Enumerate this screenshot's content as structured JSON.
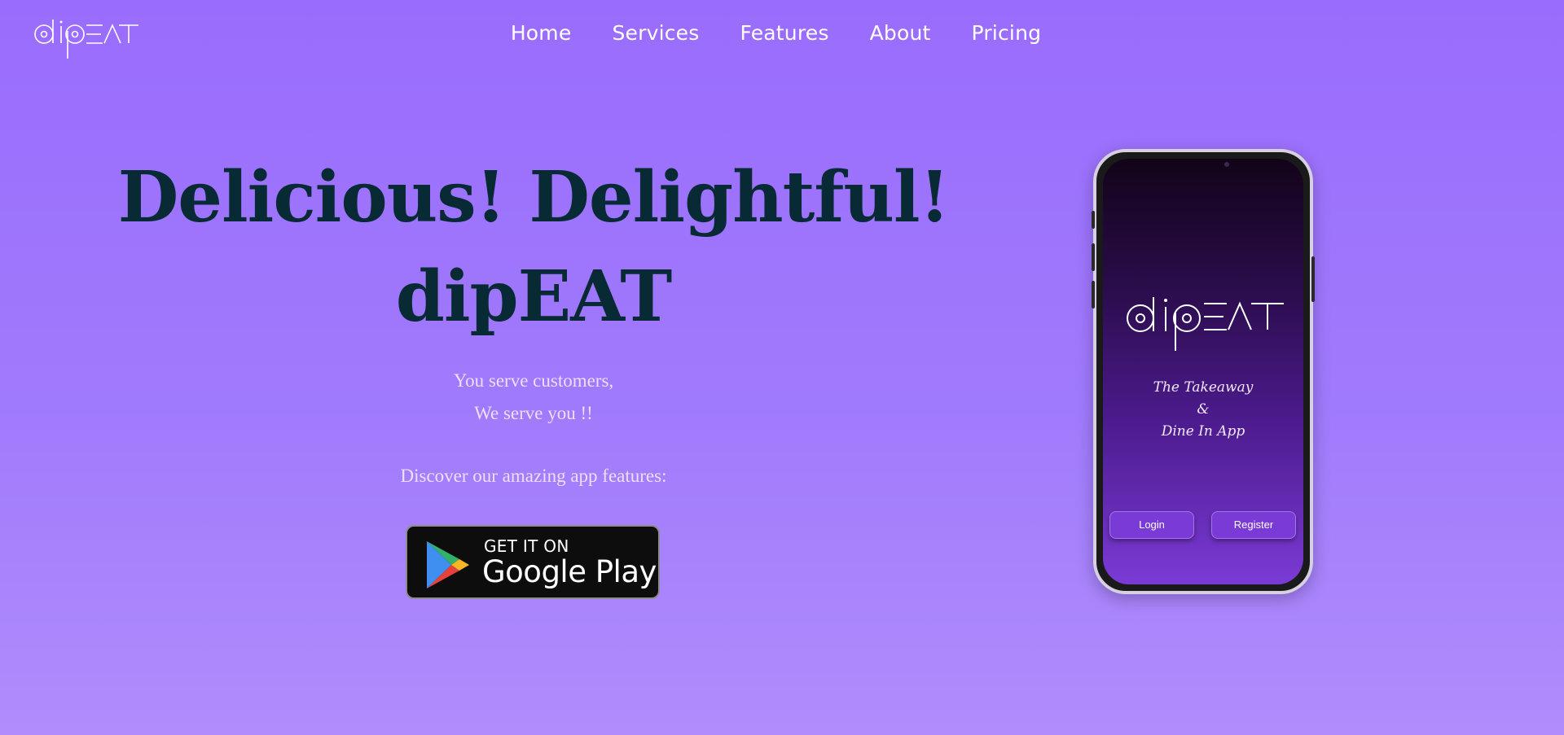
{
  "header": {
    "logo_text": "dipEAT",
    "nav": [
      {
        "label": "Home"
      },
      {
        "label": "Services"
      },
      {
        "label": "Features"
      },
      {
        "label": "About"
      },
      {
        "label": "Pricing"
      }
    ]
  },
  "hero": {
    "title_line1": "Delicious! Delightful!",
    "title_line2": "dipEAT",
    "sub_line1": "You serve customers,",
    "sub_line2": "We serve you !!",
    "features_prompt": "Discover our amazing app features:",
    "store_badge": {
      "top": "GET IT ON",
      "bottom": "Google Play"
    }
  },
  "phone": {
    "logo_text": "dipEAT",
    "tagline": [
      "The Takeaway",
      "&",
      "Dine In App"
    ],
    "login_label": "Login",
    "register_label": "Register"
  },
  "colors": {
    "accent": "#9a6cfd",
    "title": "#082a35",
    "phone_button": "#7a3ad6"
  }
}
